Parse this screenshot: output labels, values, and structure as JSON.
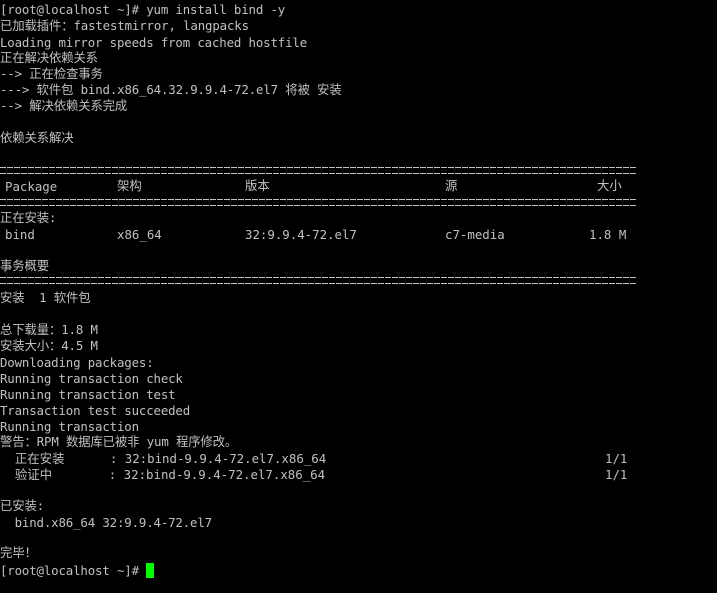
{
  "terminal": {
    "lines": {
      "cmd": "[root@localhost ~]# yum install bind -y",
      "plugins": "已加载插件：fastestmirror, langpacks",
      "mirror": "Loading mirror speeds from cached hostfile",
      "resolving": "正在解决依赖关系",
      "checking": "--> 正在检查事务",
      "pkg_install": "---> 软件包 bind.x86_64.32.9.9.4-72.el7 将被 安装",
      "resolve_done": "--> 解决依赖关系完成",
      "deps_resolved": "依赖关系解决",
      "installing_header": "正在安装:",
      "summary_title": "事务概要",
      "install_count": "安装  1 软件包",
      "total_download": "总下载量：1.8 M",
      "install_size": "安装大小：4.5 M",
      "downloading": "Downloading packages:",
      "run_check": "Running transaction check",
      "run_test": "Running transaction test",
      "test_ok": "Transaction test succeeded",
      "running": "Running transaction",
      "warning": "警告：RPM 数据库已被非 yum 程序修改。",
      "installed_header": "已安装:",
      "installed_pkg": "  bind.x86_64 32:9.9.4-72.el7",
      "done": "完毕！",
      "prompt": "[root@localhost ~]# "
    },
    "table": {
      "headers": [
        "Package",
        "架构",
        "版本",
        "源",
        "大小"
      ],
      "rows": [
        [
          "bind",
          "x86_64",
          "32:9.9.4-72.el7",
          "c7-media",
          "1.8 M"
        ]
      ]
    },
    "progress": [
      {
        "label": "  正在安装",
        "pkg": "    : 32:bind-9.9.4-72.el7.x86_64",
        "count": "1/1"
      },
      {
        "label": "  验证中",
        "pkg": "      : 32:bind-9.9.4-72.el7.x86_64",
        "count": "1/1"
      }
    ],
    "cursor_color": "#00ff00",
    "text_color": "#c0c0c0"
  }
}
